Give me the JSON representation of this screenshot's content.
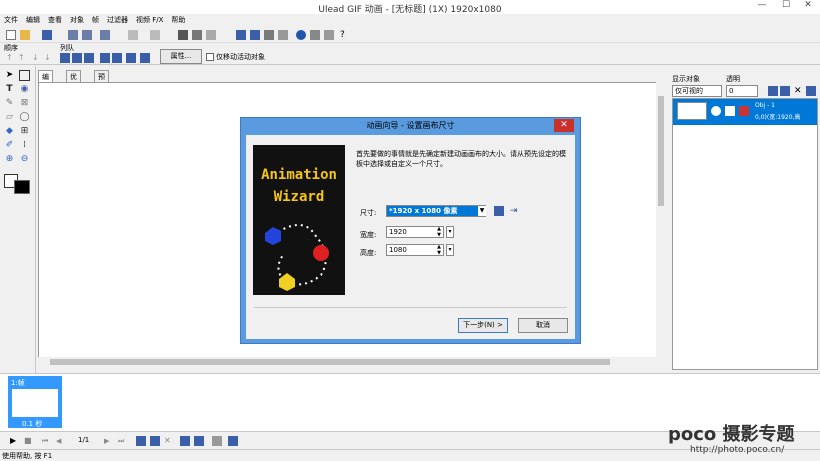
{
  "window": {
    "title": "Ulead GIF 动画 - [无标题] (1X) 1920x1080",
    "minimize": "—",
    "maximize": "☐",
    "close": "✕"
  },
  "menu": [
    "文件",
    "编辑",
    "查看",
    "对象",
    "帧",
    "过滤器",
    "视频 F/X",
    "帮助"
  ],
  "toolbar2": {
    "order_label": "顺序",
    "arrange_label": "列队",
    "properties_button": "属性...",
    "move_active_only": "仅移动活动对象"
  },
  "tabs": [
    "编辑",
    "优化",
    "预览"
  ],
  "right_panel": {
    "show_objects_label": "显示对象",
    "visible_select": "仅可视的",
    "opacity_label": "透明",
    "opacity_value": "0",
    "obj_name": "Obj - 1",
    "obj_info": "0,0)(宽:1920,高"
  },
  "frame": {
    "label": "1:帧",
    "delay": "0.1 秒",
    "counter": "1/1"
  },
  "status": "使用帮助, 按 F1",
  "watermark": {
    "brand": "poco 摄影专题",
    "url": "http://photo.poco.cn/"
  },
  "dialog": {
    "title": "动画向导 - 设置画布尺寸",
    "close": "✕",
    "description": "首先要做的事情就是先确定新建动画画布的大小。请从预先设定的模板中选择或自定义一个尺寸。",
    "wizard_line1": "Animation",
    "wizard_line2": "Wizard",
    "size_label": "尺寸:",
    "size_value": "*1920 x 1080 像素",
    "width_label": "宽度:",
    "width_value": "1920",
    "height_label": "高度:",
    "height_value": "1080",
    "next_button": "下一步(N) >",
    "cancel_button": "取消"
  },
  "colors": {
    "accent": "#0078d7",
    "dialog_border": "#5a9be0",
    "close": "#c9302c",
    "wizard_text": "#f5c518"
  }
}
